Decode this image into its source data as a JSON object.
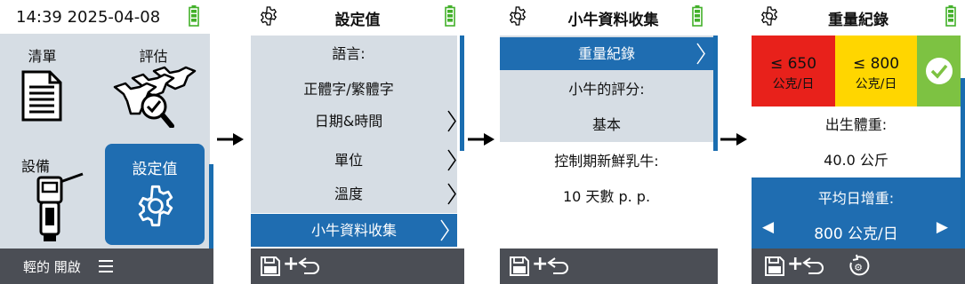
{
  "colors": {
    "accent": "#1f6db1",
    "panel": "#d6dde4",
    "footer": "#4b4e55",
    "red": "#e8211b",
    "yellow": "#ffd600",
    "green": "#7dc242",
    "battery": "#43b02a"
  },
  "screen1": {
    "time": "14:39 2025-04-08",
    "tiles": [
      {
        "label": "清單",
        "icon": "list-document-icon"
      },
      {
        "label": "評估",
        "icon": "cow-evaluation-icon"
      },
      {
        "label": "設備",
        "icon": "handheld-device-icon"
      },
      {
        "label": "設定值",
        "icon": "gear-icon"
      }
    ],
    "footer_text": "輕的 開啟",
    "footer_icon": "menu-icon"
  },
  "screen2": {
    "title": "設定值",
    "items": [
      {
        "label": "語言:",
        "chevron": false
      },
      {
        "label": "正體字/繁體字",
        "chevron": false
      },
      {
        "label": "日期&時間",
        "chevron": true
      },
      {
        "label": "單位",
        "chevron": true
      },
      {
        "label": "溫度",
        "chevron": true
      },
      {
        "label": "小牛資料收集",
        "chevron": true,
        "selected": true
      }
    ],
    "footer_icons": [
      "save-icon",
      "plus-icon",
      "back-arrow-icon"
    ]
  },
  "screen3": {
    "title": "小牛資料收集",
    "items": [
      {
        "label": "重量紀錄",
        "chevron": true,
        "selected": true
      },
      {
        "label": "小牛的評分:"
      },
      {
        "label": "基本"
      },
      {
        "label": "控制期新鮮乳牛:"
      },
      {
        "label": "10 天數 p. p."
      }
    ],
    "footer_icons": [
      "save-icon",
      "plus-icon",
      "back-arrow-icon"
    ]
  },
  "screen4": {
    "title": "重量紀錄",
    "thresholds": [
      {
        "symbol": "≤ 650",
        "unit": "公克/日",
        "color": "red"
      },
      {
        "symbol": "≤ 800",
        "unit": "公克/日",
        "color": "yellow"
      },
      {
        "icon": "check-icon",
        "color": "green"
      }
    ],
    "birth_weight_label": "出生體重:",
    "birth_weight_value": "40.0 公斤",
    "avg_gain_label": "平均日增重:",
    "avg_gain_value": "800 公克/日",
    "footer_icons": [
      "save-icon",
      "plus-icon",
      "back-arrow-icon",
      "reset-icon"
    ]
  }
}
